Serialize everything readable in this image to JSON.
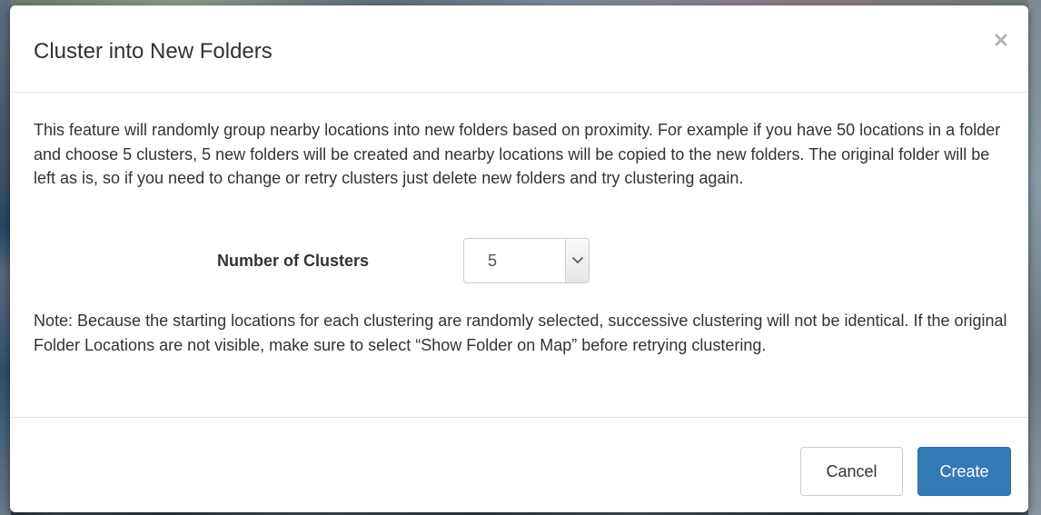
{
  "colors": {
    "primary_button": "#337ab7",
    "text": "#333333",
    "border": "#cccccc"
  },
  "dialog": {
    "title": "Cluster into New Folders",
    "close_icon": "close-icon",
    "intro_text": "This feature will randomly group nearby locations into new folders based on proximity. For example if you have 50 locations in a folder and choose 5 clusters, 5 new folders will be created and nearby locations will be copied to the new folders. The original folder will be left as is, so if you need to change or retry clusters just delete new folders and try clustering again.",
    "clusters": {
      "label": "Number of Clusters",
      "selected_value": "5",
      "arrow_icon": "chevron-down-icon"
    },
    "note_text": "Note: Because the starting locations for each clustering are randomly selected, successive clustering will not be identical. If the original Folder Locations are not visible, make sure to select “Show Folder on Map” before retrying clustering.",
    "buttons": {
      "cancel_label": "Cancel",
      "create_label": "Create"
    }
  }
}
